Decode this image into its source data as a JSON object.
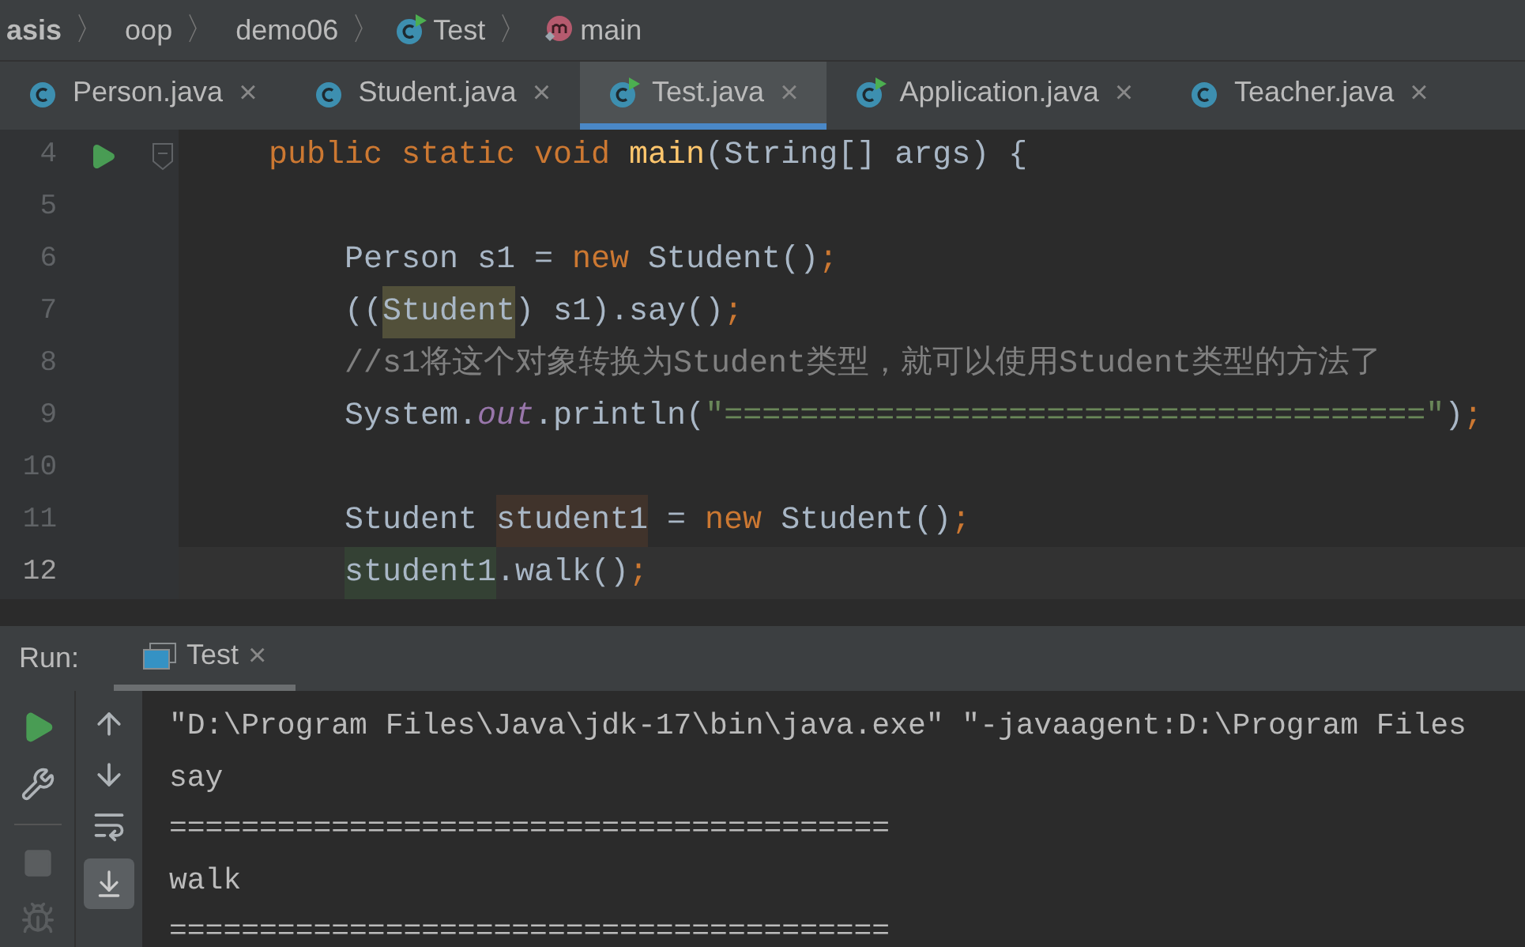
{
  "breadcrumbs": [
    {
      "label": "asis",
      "kind": "folder",
      "bold": true
    },
    {
      "separator": "〉",
      "label": "oop",
      "kind": "folder",
      "bold": false
    },
    {
      "separator": "〉",
      "label": "demo06",
      "kind": "folder",
      "bold": false
    },
    {
      "separator": "〉",
      "label": "Test",
      "kind": "class",
      "bold": false
    },
    {
      "separator": "〉",
      "label": "main",
      "kind": "method",
      "bold": false
    }
  ],
  "tabs": [
    {
      "label": "Person.java",
      "selected": false,
      "runnable": false,
      "close": "×"
    },
    {
      "label": "Student.java",
      "selected": false,
      "runnable": false,
      "close": "×"
    },
    {
      "label": "Test.java",
      "selected": true,
      "runnable": true,
      "close": "×"
    },
    {
      "label": "Application.java",
      "selected": false,
      "runnable": true,
      "close": "×"
    },
    {
      "label": "Teacher.java",
      "selected": false,
      "runnable": false,
      "close": "×"
    }
  ],
  "editor": {
    "lines": [
      {
        "number": "4",
        "current": false,
        "kind": "method-declaration",
        "tokens": [
          {
            "text": "public static void ",
            "kind": "keyword"
          },
          {
            "text": "main",
            "kind": "method"
          },
          {
            "text": "(String[] args) {",
            "kind": "plain"
          }
        ]
      },
      {
        "number": "5",
        "current": false,
        "kind": "blank"
      },
      {
        "number": "6",
        "current": false,
        "kind": "statement",
        "tokens": [
          {
            "text": "Person s1 = ",
            "kind": "plain"
          },
          {
            "text": "new ",
            "kind": "keyword"
          },
          {
            "text": "Student()",
            "kind": "plain"
          },
          {
            "text": ";",
            "kind": "keyword"
          }
        ]
      },
      {
        "number": "7",
        "current": false,
        "kind": "statement",
        "tokens": [
          {
            "text": "((",
            "kind": "plain"
          },
          {
            "text": "Student",
            "kind": "type-usage"
          },
          {
            "text": ") s1).say()",
            "kind": "plain"
          },
          {
            "text": ";",
            "kind": "keyword"
          }
        ]
      },
      {
        "number": "8",
        "current": false,
        "kind": "statement",
        "tokens": [
          {
            "text": "//s1将这个对象转换为Student类型，就可以使用Student类型的方法了",
            "kind": "comment"
          }
        ]
      },
      {
        "number": "9",
        "current": false,
        "kind": "statement",
        "tokens": [
          {
            "text": "System.",
            "kind": "plain"
          },
          {
            "text": "out",
            "kind": "field"
          },
          {
            "text": ".println(",
            "kind": "plain"
          },
          {
            "text": "\"=====================================\"",
            "kind": "string"
          },
          {
            "text": ")",
            "kind": "plain"
          },
          {
            "text": ";",
            "kind": "keyword"
          }
        ]
      },
      {
        "number": "10",
        "current": false,
        "kind": "blank"
      },
      {
        "number": "11",
        "current": false,
        "kind": "statement",
        "tokens": [
          {
            "text": "Student ",
            "kind": "plain"
          },
          {
            "text": "student1",
            "kind": "write-usage"
          },
          {
            "text": " = ",
            "kind": "plain"
          },
          {
            "text": "new ",
            "kind": "keyword"
          },
          {
            "text": "Student()",
            "kind": "plain"
          },
          {
            "text": ";",
            "kind": "keyword"
          }
        ]
      },
      {
        "number": "12",
        "current": true,
        "kind": "statement",
        "tokens": [
          {
            "text": "student1",
            "kind": "read-usage"
          },
          {
            "text": ".walk()",
            "kind": "plain"
          },
          {
            "text": ";",
            "kind": "keyword"
          }
        ]
      }
    ]
  },
  "run_panel": {
    "label": "Run:",
    "tab": {
      "label": "Test",
      "close": "×",
      "selected": true
    },
    "console": [
      "\"D:\\Program Files\\Java\\jdk-17\\bin\\java.exe\" \"-javaagent:D:\\Program Files",
      "say",
      "========================================",
      "walk",
      "========================================"
    ]
  }
}
